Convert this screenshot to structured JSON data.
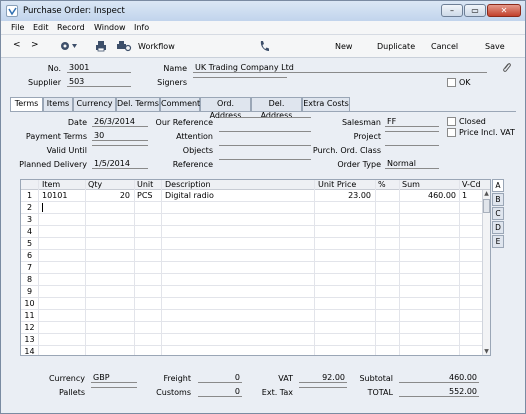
{
  "window": {
    "title": "Purchase Order: Inspect"
  },
  "menu": [
    "File",
    "Edit",
    "Record",
    "Window",
    "Info"
  ],
  "toolbar": {
    "workflow": "Workflow",
    "new": "New",
    "duplicate": "Duplicate",
    "cancel": "Cancel",
    "save": "Save"
  },
  "header": {
    "no_label": "No.",
    "no": "3001",
    "supplier_label": "Supplier",
    "supplier": "503",
    "name_label": "Name",
    "name": "UK Trading Company Ltd",
    "signers_label": "Signers",
    "signers": "",
    "ok_label": "OK"
  },
  "tabs": [
    "Terms",
    "Items",
    "Currency",
    "Del. Terms",
    "Comment",
    "Ord. Address",
    "Del. Address",
    "Extra Costs"
  ],
  "terms": {
    "date_label": "Date",
    "date": "26/3/2014",
    "payment_terms_label": "Payment Terms",
    "payment_terms": "30",
    "valid_until_label": "Valid Until",
    "valid_until": "",
    "planned_delivery_label": "Planned Delivery",
    "planned_delivery": "1/5/2014",
    "our_reference_label": "Our Reference",
    "our_reference": "",
    "attention_label": "Attention",
    "attention": "",
    "objects_label": "Objects",
    "objects": "",
    "reference_label": "Reference",
    "reference": "",
    "salesman_label": "Salesman",
    "salesman": "FF",
    "project_label": "Project",
    "project": "",
    "purch_ord_class_label": "Purch. Ord. Class",
    "purch_ord_class": "",
    "order_type_label": "Order Type",
    "order_type": "Normal",
    "closed_label": "Closed",
    "price_incl_vat_label": "Price Incl. VAT"
  },
  "grid": {
    "columns": [
      "Item",
      "Qty",
      "Unit",
      "Description",
      "Unit Price",
      "%",
      "Sum",
      "V-Cd"
    ],
    "rows": [
      {
        "n": "1",
        "item": "10101",
        "qty": "20",
        "unit": "PCS",
        "description": "Digital radio",
        "unit_price": "23.00",
        "pct": "",
        "sum": "460.00",
        "vcd": "1"
      },
      {
        "n": "2"
      },
      {
        "n": "3"
      },
      {
        "n": "4"
      },
      {
        "n": "5"
      },
      {
        "n": "6"
      },
      {
        "n": "7"
      },
      {
        "n": "8"
      },
      {
        "n": "9"
      },
      {
        "n": "10"
      },
      {
        "n": "11"
      },
      {
        "n": "12"
      },
      {
        "n": "13"
      },
      {
        "n": "14"
      }
    ],
    "side_tabs": [
      "A",
      "B",
      "C",
      "D",
      "E"
    ]
  },
  "footer": {
    "currency_label": "Currency",
    "currency": "GBP",
    "pallets_label": "Pallets",
    "pallets": "",
    "freight_label": "Freight",
    "freight": "0",
    "customs_label": "Customs",
    "customs": "0",
    "vat_label": "VAT",
    "vat": "92.00",
    "ext_tax_label": "Ext. Tax",
    "ext_tax": "",
    "subtotal_label": "Subtotal",
    "subtotal": "460.00",
    "total_label": "TOTAL",
    "total": "552.00"
  }
}
